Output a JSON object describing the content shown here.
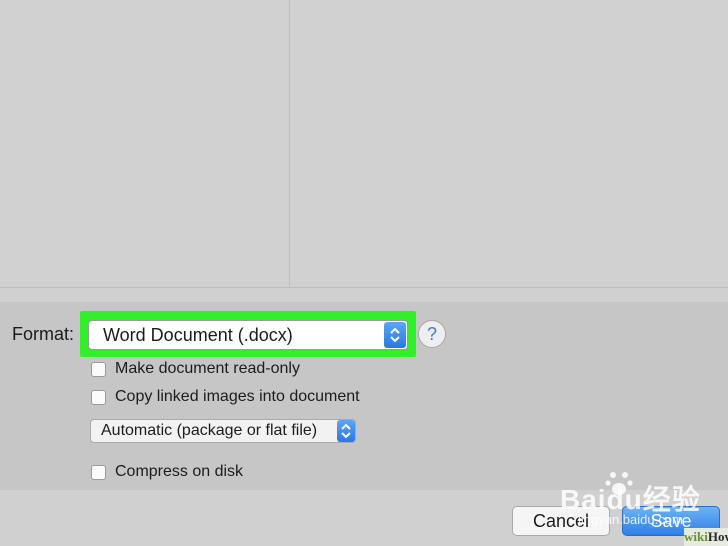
{
  "options": {
    "format_label": "Format:",
    "format_value": "Word Document (.docx)",
    "help_label": "?",
    "checkboxes": [
      {
        "label": "Make document read-only",
        "checked": false
      },
      {
        "label": "Copy linked images into document",
        "checked": false
      },
      {
        "label": "Compress on disk",
        "checked": false
      }
    ],
    "package_value": "Automatic (package or flat file)"
  },
  "buttons": {
    "cancel": "Cancel",
    "save": "Save"
  },
  "watermarks": {
    "baidu": "Baidu经验",
    "url": "jingyan.baidu.com",
    "wikihow_wiki": "wiki",
    "wikihow_how": "How"
  },
  "colors": {
    "highlight": "#33ee2b",
    "accent_blue": "#2f7fe6"
  },
  "icons": {
    "format_select": "updown-chevron-icon",
    "package_select": "updown-chevron-icon",
    "help": "question-icon"
  }
}
